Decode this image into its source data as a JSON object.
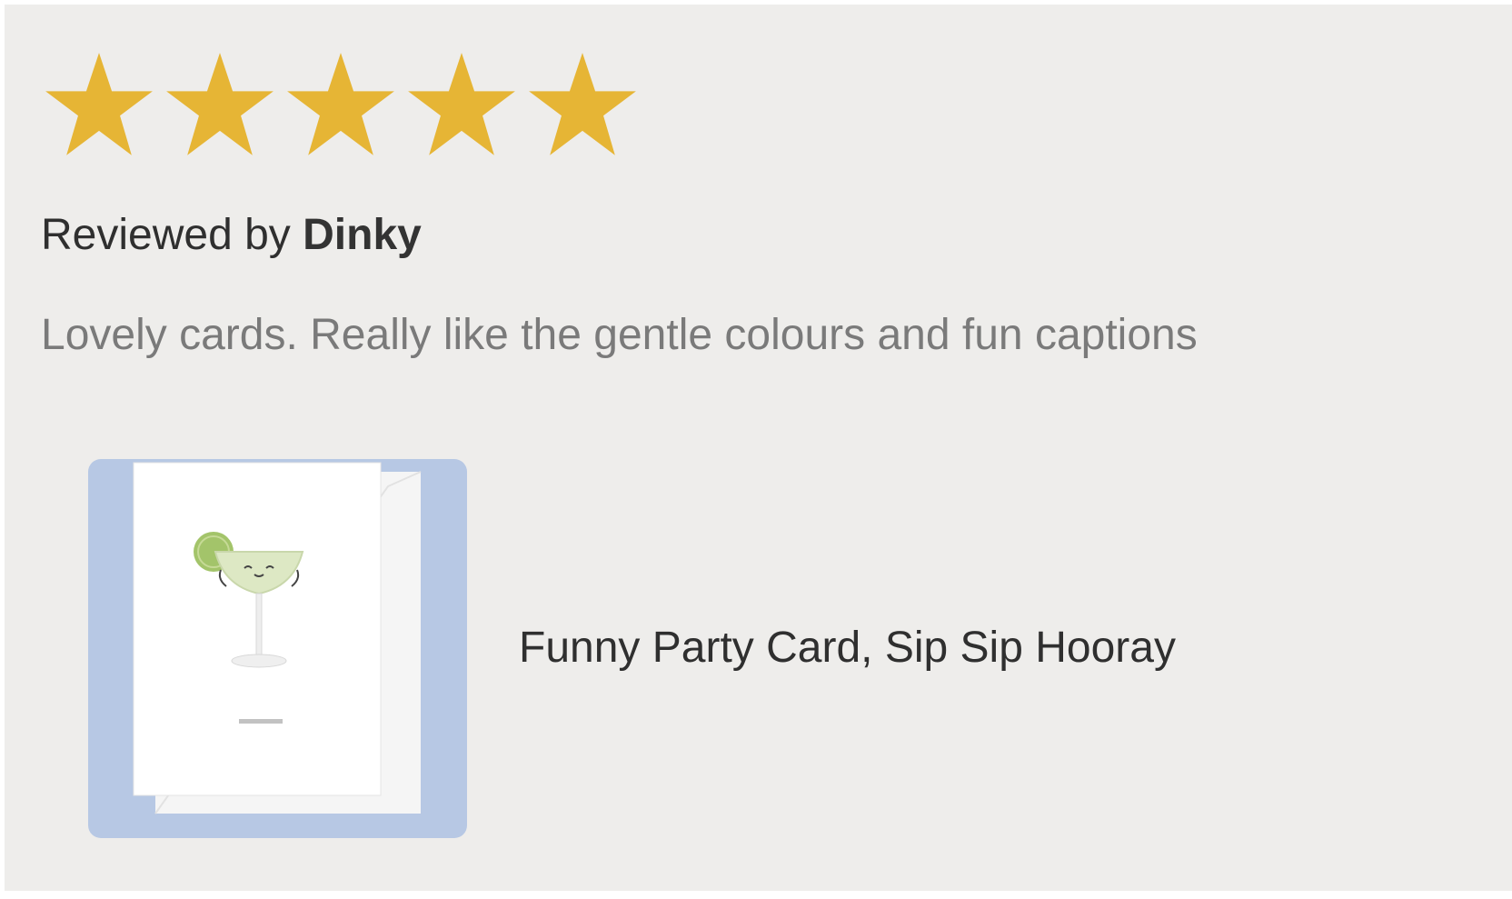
{
  "review": {
    "rating": 5,
    "rating_max": 5,
    "star_color": "#e6b535",
    "reviewed_by_prefix": "Reviewed by ",
    "reviewer_name": "Dinky",
    "text": "Lovely cards. Really like the gentle colours and fun captions"
  },
  "product": {
    "title": "Funny Party Card, Sip Sip Hooray",
    "thumbnail_icon": "margarita-card-icon",
    "thumbnail_bg": "#b7c8e4"
  }
}
